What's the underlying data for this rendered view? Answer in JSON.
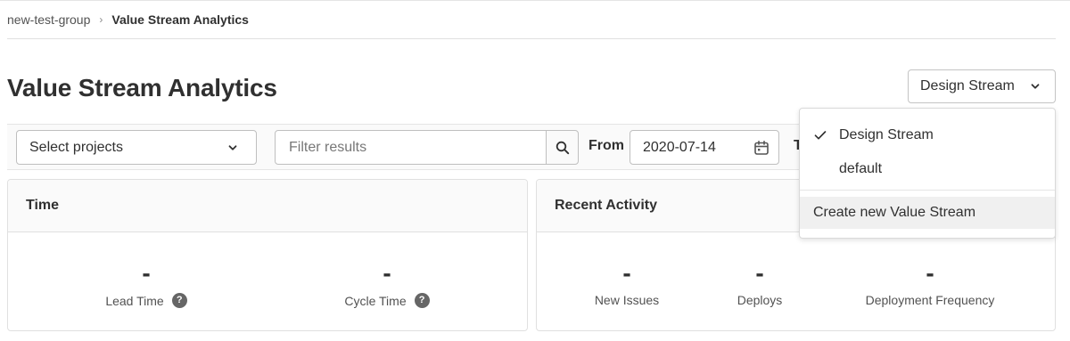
{
  "breadcrumb": {
    "group": "new-test-group",
    "separator": "›",
    "current": "Value Stream Analytics"
  },
  "page": {
    "title": "Value Stream Analytics"
  },
  "value_stream_selector": {
    "selected": "Design Stream",
    "icon": "chevron-down-icon"
  },
  "filters": {
    "projects_placeholder": "Select projects",
    "search_placeholder": "Filter results",
    "search_icon": "search-icon",
    "from_label": "From",
    "from_date": "2020-07-14",
    "to_label": "T",
    "calendar_icon": "calendar-icon"
  },
  "time_card": {
    "title": "Time",
    "metrics": [
      {
        "value": "-",
        "label": "Lead Time",
        "help": "?"
      },
      {
        "value": "-",
        "label": "Cycle Time",
        "help": "?"
      }
    ]
  },
  "activity_card": {
    "title": "Recent Activity",
    "metrics": [
      {
        "value": "-",
        "label": "New Issues"
      },
      {
        "value": "-",
        "label": "Deploys"
      },
      {
        "value": "-",
        "label": "Deployment Frequency"
      }
    ]
  },
  "dropdown": {
    "items": [
      {
        "label": "Design Stream",
        "checked": true
      },
      {
        "label": "default",
        "checked": false
      }
    ],
    "create_label": "Create new Value Stream"
  },
  "colors": {
    "text": "#303030",
    "muted": "#525252",
    "border": "#bfbfbf",
    "header_bg": "#fafafa",
    "help_icon_bg": "#666666"
  }
}
